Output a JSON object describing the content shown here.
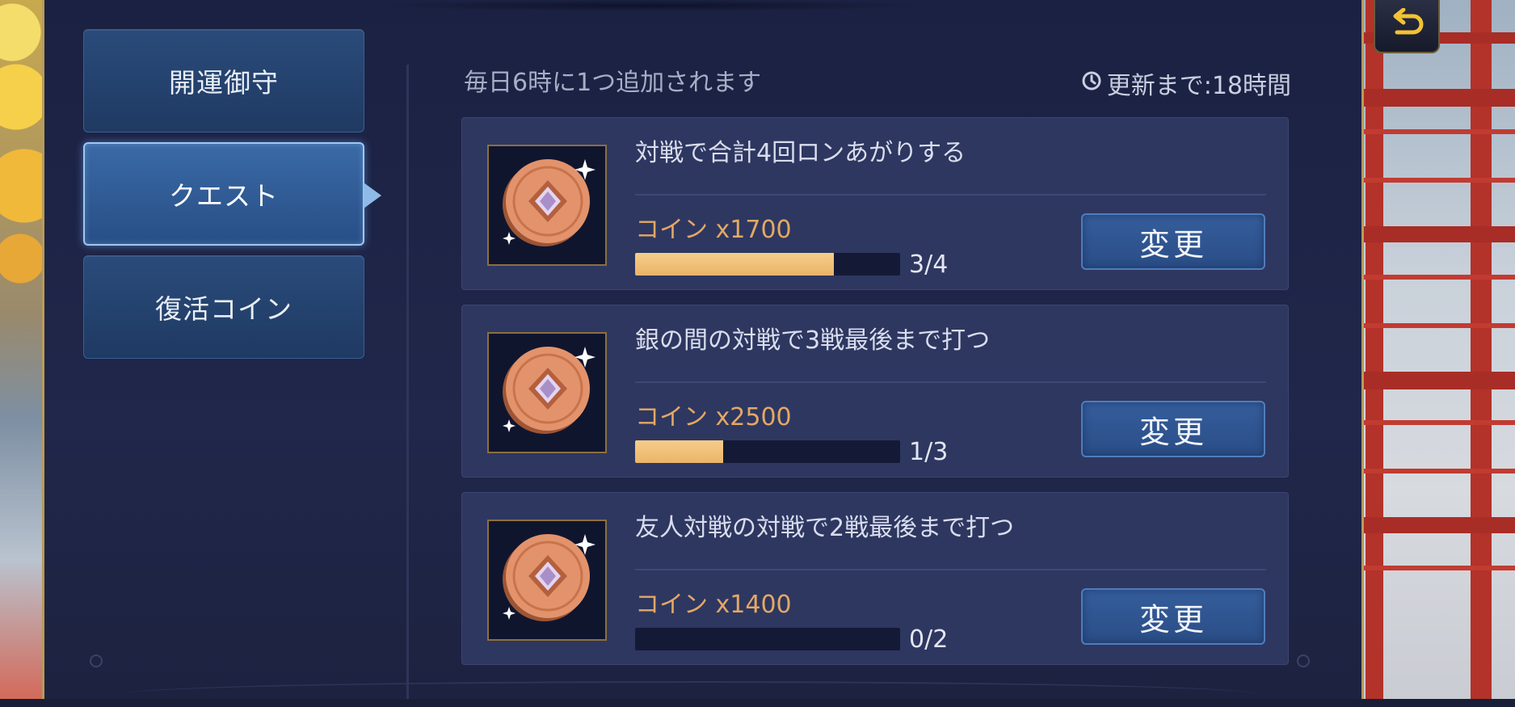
{
  "sidebar": {
    "tabs": [
      {
        "label": "開運御守",
        "active": false
      },
      {
        "label": "クエスト",
        "active": true
      },
      {
        "label": "復活コイン",
        "active": false
      }
    ]
  },
  "header": {
    "note": "毎日6時に1つ追加されます",
    "refresh_icon": "clock-icon",
    "refresh_text": "更新まで:18時間"
  },
  "quests": [
    {
      "title": "対戦で合計4回ロンあがりする",
      "reward": "コイン x1700",
      "progress_text": "3/4",
      "progress_fraction": 0.75,
      "button_label": "変更"
    },
    {
      "title": "銀の間の対戦で3戦最後まで打つ",
      "reward": "コイン x2500",
      "progress_text": "1/3",
      "progress_fraction": 0.333,
      "button_label": "変更"
    },
    {
      "title": "友人対戦の対戦で2戦最後まで打つ",
      "reward": "コイン x1400",
      "progress_text": "0/2",
      "progress_fraction": 0,
      "button_label": "変更"
    }
  ],
  "colors": {
    "accent_gold": "#e3a865",
    "progress_fill": "#f0bd73",
    "tab_active_border": "#9ec8f2"
  },
  "icons": {
    "back": "back-arrow-icon",
    "reward": "coin-icon"
  }
}
